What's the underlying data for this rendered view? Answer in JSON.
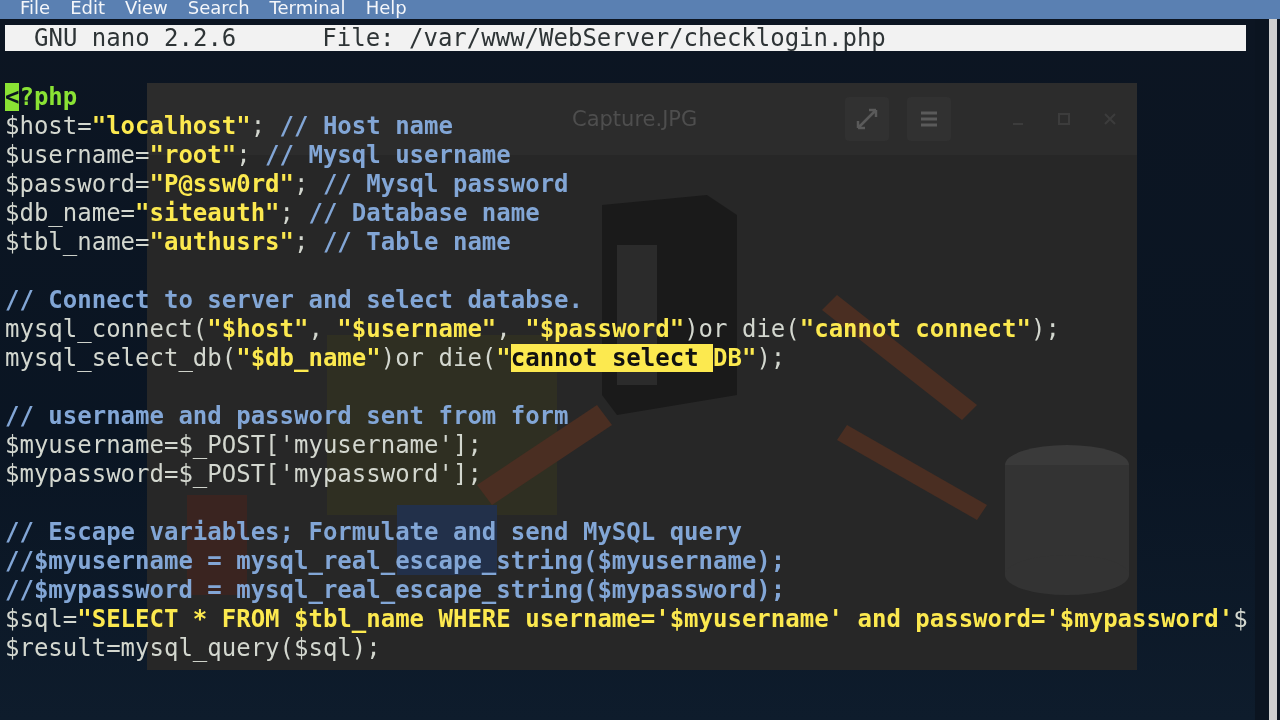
{
  "menu_bar": {
    "items": [
      "File",
      "Edit",
      "View",
      "Search",
      "Terminal",
      "Help"
    ]
  },
  "background_window": {
    "title": "Capture.JPG"
  },
  "editor": {
    "version": "GNU nano 2.2.6",
    "file": "File: /var/www/WebServer/checklogin.php",
    "blocks": [
      [
        [
          {
            "text": "<",
            "kind": "cursor"
          },
          {
            "text": "?php",
            "kind": "php"
          }
        ],
        [
          {
            "text": "$host=",
            "kind": "plain"
          },
          {
            "text": "\"localhost\"",
            "kind": "string"
          },
          {
            "text": "; ",
            "kind": "plain"
          },
          {
            "text": "// Host name",
            "kind": "comment"
          }
        ],
        [
          {
            "text": "$username=",
            "kind": "plain"
          },
          {
            "text": "\"root\"",
            "kind": "string"
          },
          {
            "text": "; ",
            "kind": "plain"
          },
          {
            "text": "// Mysql username",
            "kind": "comment"
          }
        ],
        [
          {
            "text": "$password=",
            "kind": "plain"
          },
          {
            "text": "\"P@ssw0rd\"",
            "kind": "string"
          },
          {
            "text": "; ",
            "kind": "plain"
          },
          {
            "text": "// Mysql password",
            "kind": "comment"
          }
        ],
        [
          {
            "text": "$db_name=",
            "kind": "plain"
          },
          {
            "text": "\"siteauth\"",
            "kind": "string"
          },
          {
            "text": "; ",
            "kind": "plain"
          },
          {
            "text": "// Database name",
            "kind": "comment"
          }
        ],
        [
          {
            "text": "$tbl_name=",
            "kind": "plain"
          },
          {
            "text": "\"authusrs\"",
            "kind": "string"
          },
          {
            "text": "; ",
            "kind": "plain"
          },
          {
            "text": "// Table name",
            "kind": "comment"
          }
        ]
      ],
      [
        [
          {
            "text": "// Connect to server and select databse.",
            "kind": "comment"
          }
        ],
        [
          {
            "text": "mysql_connect(",
            "kind": "plain"
          },
          {
            "text": "\"$host\"",
            "kind": "string"
          },
          {
            "text": ", ",
            "kind": "plain"
          },
          {
            "text": "\"$username\"",
            "kind": "string"
          },
          {
            "text": ", ",
            "kind": "plain"
          },
          {
            "text": "\"$password\"",
            "kind": "string"
          },
          {
            "text": ")or die(",
            "kind": "plain"
          },
          {
            "text": "\"cannot connect\"",
            "kind": "string"
          },
          {
            "text": ");",
            "kind": "plain"
          }
        ],
        [
          {
            "text": "mysql_select_db(",
            "kind": "plain"
          },
          {
            "text": "\"$db_name\"",
            "kind": "string"
          },
          {
            "text": ")or die(",
            "kind": "plain"
          },
          {
            "text": "\"",
            "kind": "string"
          },
          {
            "text": "cannot select ",
            "kind": "selection"
          },
          {
            "text": "DB\"",
            "kind": "string"
          },
          {
            "text": ");",
            "kind": "plain"
          }
        ]
      ],
      [
        [
          {
            "text": "// username and password sent from form",
            "kind": "comment"
          }
        ],
        [
          {
            "text": "$myusername=$_POST['myusername'];",
            "kind": "plain"
          }
        ],
        [
          {
            "text": "$mypassword=$_POST['mypassword'];",
            "kind": "plain"
          }
        ]
      ],
      [
        [
          {
            "text": "// Escape variables; Formulate and send MySQL query",
            "kind": "comment"
          }
        ],
        [
          {
            "text": "//$myusername = mysql_real_escape_string($myusername);",
            "kind": "comment"
          }
        ],
        [
          {
            "text": "//$mypassword = mysql_real_escape_string($mypassword);",
            "kind": "comment"
          }
        ],
        [
          {
            "text": "$sql=",
            "kind": "plain"
          },
          {
            "text": "\"SELECT * FROM $tbl_name WHERE username='$myusername' and password='$mypassword'",
            "kind": "string"
          },
          {
            "text": "$",
            "kind": "plain"
          }
        ],
        [
          {
            "text": "$result=mysql_query($sql);",
            "kind": "plain"
          }
        ]
      ]
    ]
  }
}
